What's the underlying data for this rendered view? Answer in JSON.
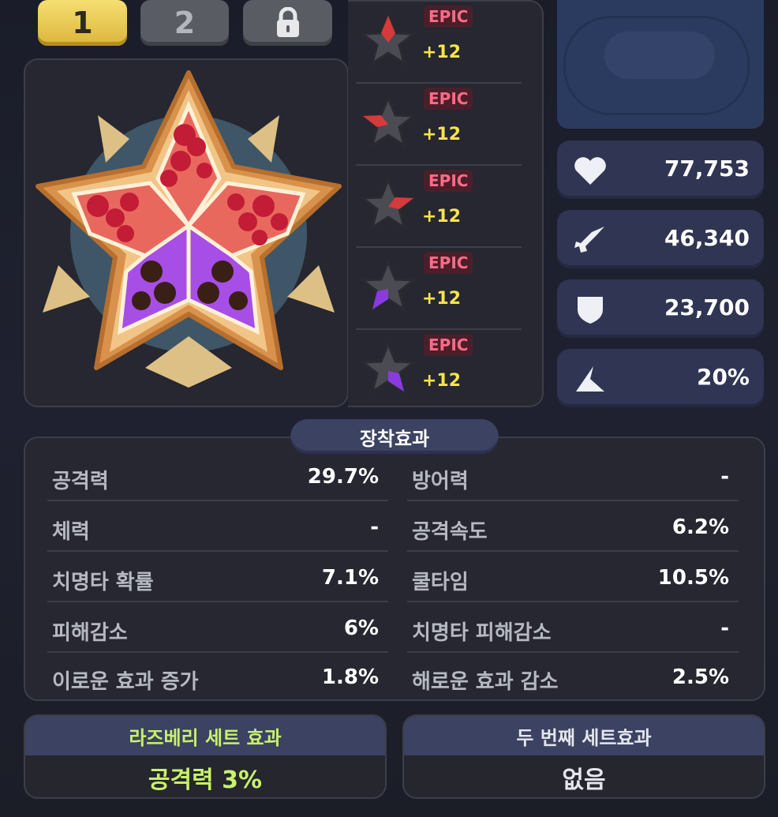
{
  "tabs": [
    {
      "label": "1",
      "selected": true
    },
    {
      "label": "2",
      "selected": false
    },
    {
      "icon": "lock-icon",
      "locked": true
    }
  ],
  "toppings": [
    {
      "grade": "EPIC",
      "level": "+12",
      "highlight_color": "#d63a3a"
    },
    {
      "grade": "EPIC",
      "level": "+12",
      "highlight_color": "#d63a3a"
    },
    {
      "grade": "EPIC",
      "level": "+12",
      "highlight_color": "#d63a3a"
    },
    {
      "grade": "EPIC",
      "level": "+12",
      "highlight_color": "#8a3adf"
    },
    {
      "grade": "EPIC",
      "level": "+12",
      "highlight_color": "#8a3adf"
    }
  ],
  "stats": [
    {
      "icon": "heart-icon",
      "value": "77,753"
    },
    {
      "icon": "sword-icon",
      "value": "46,340"
    },
    {
      "icon": "shield-icon",
      "value": "23,700"
    },
    {
      "icon": "speed-arrow-icon",
      "value": "20%"
    }
  ],
  "effects": {
    "title": "장착효과",
    "left": [
      {
        "label": "공격력",
        "value": "29.7%"
      },
      {
        "label": "체력",
        "value": "-"
      },
      {
        "label": "치명타 확률",
        "value": "7.1%"
      },
      {
        "label": "피해감소",
        "value": "6%"
      },
      {
        "label": "이로운 효과 증가",
        "value": "1.8%"
      }
    ],
    "right": [
      {
        "label": "방어력",
        "value": "-"
      },
      {
        "label": "공격속도",
        "value": "6.2%"
      },
      {
        "label": "쿨타임",
        "value": "10.5%"
      },
      {
        "label": "치명타 피해감소",
        "value": "-"
      },
      {
        "label": "해로운 효과 감소",
        "value": "2.5%"
      }
    ]
  },
  "set1": {
    "title": "라즈베리 세트 효과",
    "value": "공격력 3%"
  },
  "set2": {
    "title": "두 번째 세트효과",
    "value": "없음"
  },
  "colors": {
    "accent_yellow": "#f8e548",
    "epic_text": "#ff6b88",
    "set_green": "#c8f26a"
  }
}
